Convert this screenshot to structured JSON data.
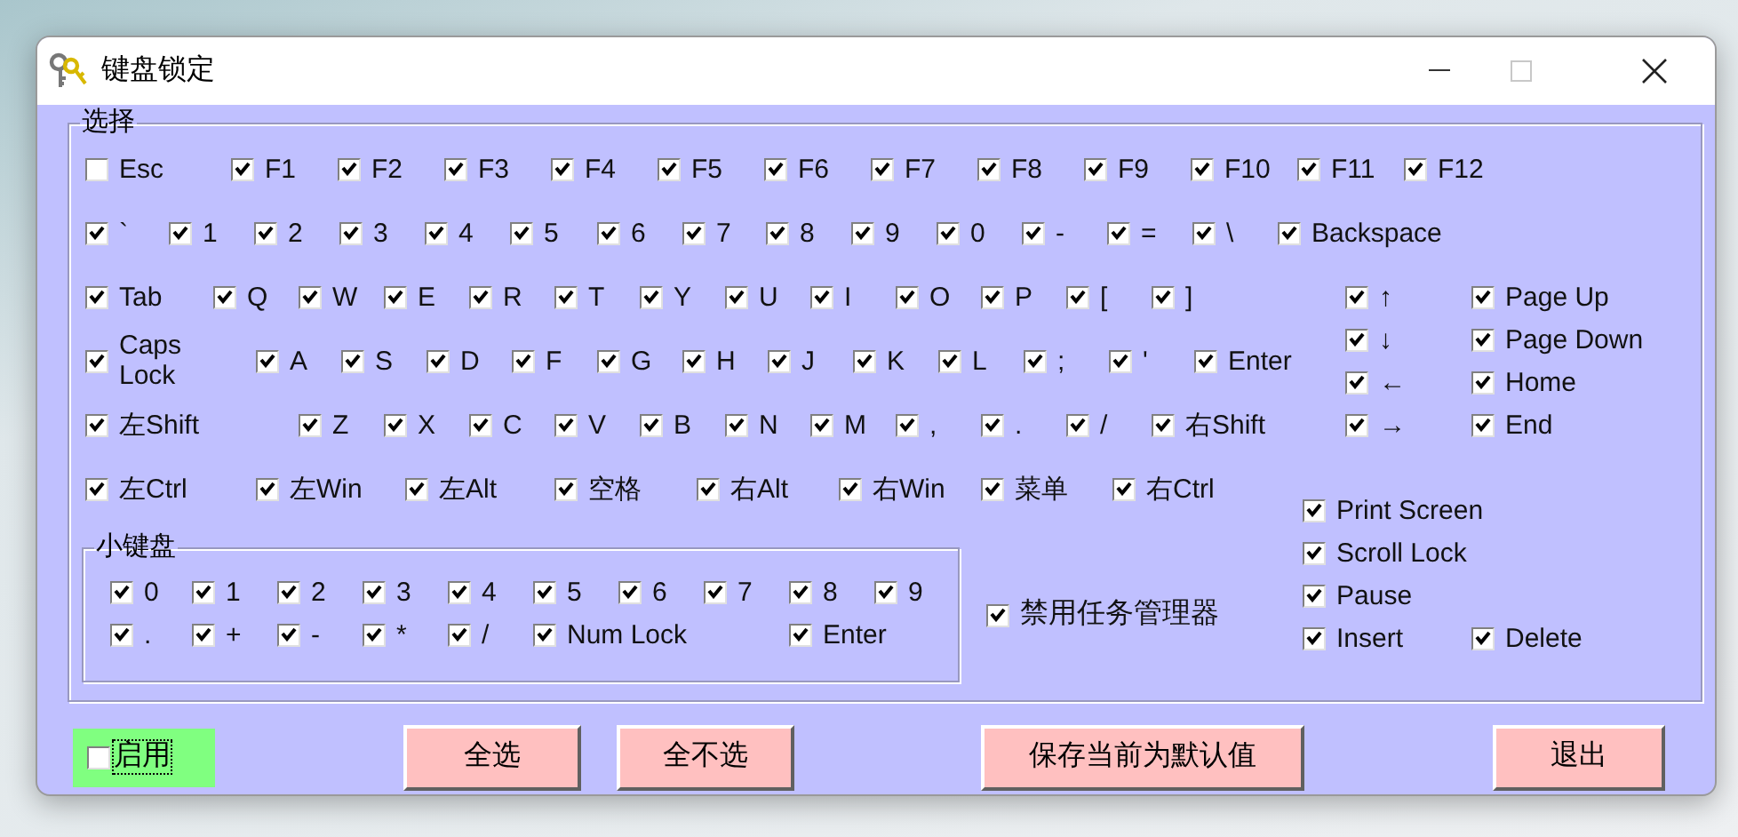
{
  "window": {
    "title": "键盘锁定"
  },
  "selection": {
    "title": "选择",
    "key_rows": [
      [
        {
          "label": "Esc",
          "checked": false
        },
        {
          "label": "F1",
          "checked": true
        },
        {
          "label": "F2",
          "checked": true
        },
        {
          "label": "F3",
          "checked": true
        },
        {
          "label": "F4",
          "checked": true
        },
        {
          "label": "F5",
          "checked": true
        },
        {
          "label": "F6",
          "checked": true
        },
        {
          "label": "F7",
          "checked": true
        },
        {
          "label": "F8",
          "checked": true
        },
        {
          "label": "F9",
          "checked": true
        },
        {
          "label": "F10",
          "checked": true
        },
        {
          "label": "F11",
          "checked": true
        },
        {
          "label": "F12",
          "checked": true
        }
      ],
      [
        {
          "label": "`",
          "checked": true
        },
        {
          "label": "1",
          "checked": true
        },
        {
          "label": "2",
          "checked": true
        },
        {
          "label": "3",
          "checked": true
        },
        {
          "label": "4",
          "checked": true
        },
        {
          "label": "5",
          "checked": true
        },
        {
          "label": "6",
          "checked": true
        },
        {
          "label": "7",
          "checked": true
        },
        {
          "label": "8",
          "checked": true
        },
        {
          "label": "9",
          "checked": true
        },
        {
          "label": "0",
          "checked": true
        },
        {
          "label": "-",
          "checked": true
        },
        {
          "label": "=",
          "checked": true
        },
        {
          "label": "\\",
          "checked": true
        },
        {
          "label": "Backspace",
          "checked": true
        }
      ],
      [
        {
          "label": "Tab",
          "checked": true
        },
        {
          "label": "Q",
          "checked": true
        },
        {
          "label": "W",
          "checked": true
        },
        {
          "label": "E",
          "checked": true
        },
        {
          "label": "R",
          "checked": true
        },
        {
          "label": "T",
          "checked": true
        },
        {
          "label": "Y",
          "checked": true
        },
        {
          "label": "U",
          "checked": true
        },
        {
          "label": "I",
          "checked": true
        },
        {
          "label": "O",
          "checked": true
        },
        {
          "label": "P",
          "checked": true
        },
        {
          "label": "[",
          "checked": true
        },
        {
          "label": "]",
          "checked": true
        }
      ],
      [
        {
          "label": "Caps Lock",
          "checked": true
        },
        {
          "label": "A",
          "checked": true
        },
        {
          "label": "S",
          "checked": true
        },
        {
          "label": "D",
          "checked": true
        },
        {
          "label": "F",
          "checked": true
        },
        {
          "label": "G",
          "checked": true
        },
        {
          "label": "H",
          "checked": true
        },
        {
          "label": "J",
          "checked": true
        },
        {
          "label": "K",
          "checked": true
        },
        {
          "label": "L",
          "checked": true
        },
        {
          "label": ";",
          "checked": true
        },
        {
          "label": "'",
          "checked": true
        },
        {
          "label": "Enter",
          "checked": true
        }
      ],
      [
        {
          "label": "左Shift",
          "checked": true
        },
        {
          "label": "Z",
          "checked": true
        },
        {
          "label": "X",
          "checked": true
        },
        {
          "label": "C",
          "checked": true
        },
        {
          "label": "V",
          "checked": true
        },
        {
          "label": "B",
          "checked": true
        },
        {
          "label": "N",
          "checked": true
        },
        {
          "label": "M",
          "checked": true
        },
        {
          "label": ",",
          "checked": true
        },
        {
          "label": ".",
          "checked": true
        },
        {
          "label": "/",
          "checked": true
        },
        {
          "label": "右Shift",
          "checked": true
        }
      ],
      [
        {
          "label": "左Ctrl",
          "checked": true
        },
        {
          "label": "左Win",
          "checked": true
        },
        {
          "label": "左Alt",
          "checked": true
        },
        {
          "label": "空格",
          "checked": true
        },
        {
          "label": "右Alt",
          "checked": true
        },
        {
          "label": "右Win",
          "checked": true
        },
        {
          "label": "菜单",
          "checked": true
        },
        {
          "label": "右Ctrl",
          "checked": true
        }
      ]
    ],
    "nav_rows": [
      [
        {
          "label": "↑",
          "checked": true
        },
        {
          "label": "Page Up",
          "checked": true
        }
      ],
      [
        {
          "label": "↓",
          "checked": true
        },
        {
          "label": "Page Down",
          "checked": true
        }
      ],
      [
        {
          "label": "←",
          "checked": true
        },
        {
          "label": "Home",
          "checked": true
        }
      ],
      [
        {
          "label": "→",
          "checked": true
        },
        {
          "label": "End",
          "checked": true
        }
      ]
    ],
    "numpad": {
      "title": "小键盘",
      "rows": [
        [
          {
            "label": "0",
            "checked": true
          },
          {
            "label": "1",
            "checked": true
          },
          {
            "label": "2",
            "checked": true
          },
          {
            "label": "3",
            "checked": true
          },
          {
            "label": "4",
            "checked": true
          },
          {
            "label": "5",
            "checked": true
          },
          {
            "label": "6",
            "checked": true
          },
          {
            "label": "7",
            "checked": true
          },
          {
            "label": "8",
            "checked": true
          },
          {
            "label": "9",
            "checked": true
          }
        ],
        [
          {
            "label": ".",
            "checked": true
          },
          {
            "label": "+",
            "checked": true
          },
          {
            "label": "-",
            "checked": true
          },
          {
            "label": "*",
            "checked": true
          },
          {
            "label": "/",
            "checked": true
          },
          {
            "label": "Num Lock",
            "checked": true
          },
          null,
          null,
          {
            "label": "Enter",
            "checked": true
          }
        ]
      ]
    },
    "disable_task_manager": {
      "label": "禁用任务管理器",
      "checked": true
    },
    "system_rows": [
      [
        {
          "label": "Print Screen",
          "checked": true
        }
      ],
      [
        {
          "label": "Scroll Lock",
          "checked": true
        }
      ],
      [
        {
          "label": "Pause",
          "checked": true
        }
      ],
      [
        {
          "label": "Insert",
          "checked": true
        },
        {
          "label": "Delete",
          "checked": true
        }
      ]
    ]
  },
  "enable": {
    "label": "启用",
    "checked": false
  },
  "buttons": [
    "全选",
    "全不选",
    "保存当前为默认值",
    "退出"
  ]
}
